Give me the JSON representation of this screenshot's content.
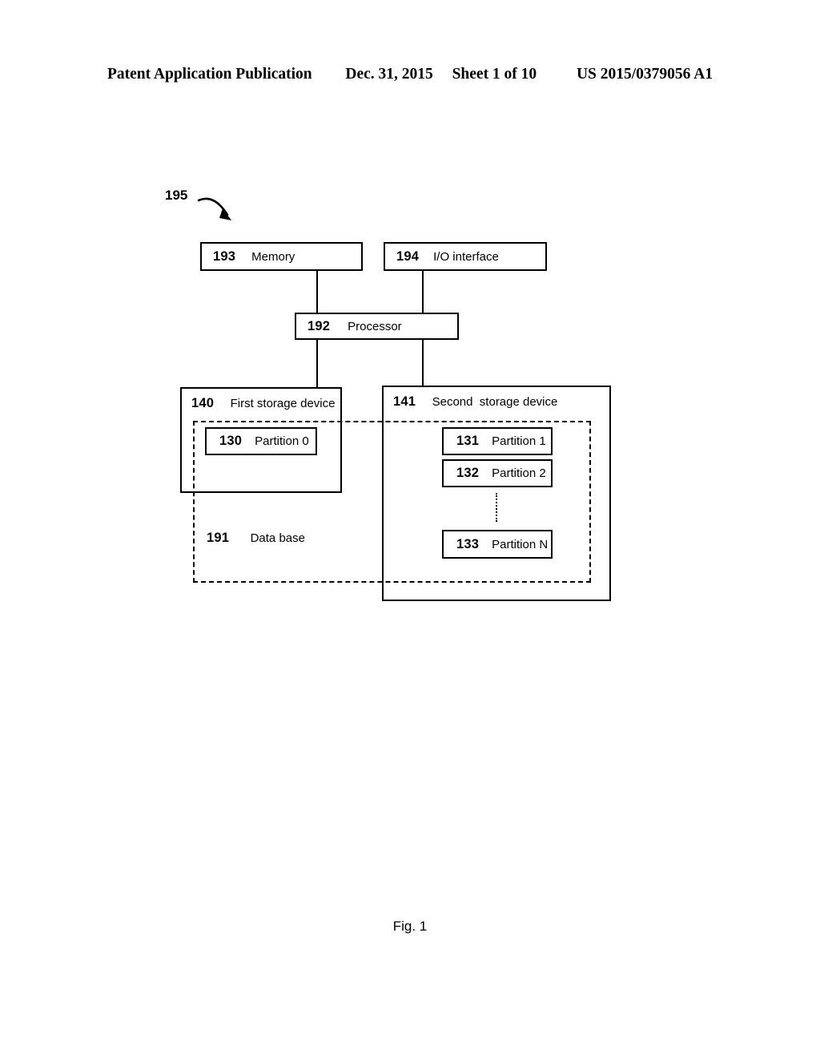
{
  "header": {
    "publication": "Patent Application Publication",
    "date": "Dec. 31, 2015",
    "sheet": "Sheet 1 of 10",
    "document_number": "US 2015/0379056 A1"
  },
  "figure": {
    "system_ref": "195",
    "caption": "Fig. 1",
    "blocks": {
      "memory": {
        "ref": "193",
        "label": "Memory"
      },
      "io": {
        "ref": "194",
        "label": "I/O interface"
      },
      "processor": {
        "ref": "192",
        "label": "Processor"
      },
      "first_storage": {
        "ref": "140",
        "label": "First storage device"
      },
      "second_storage": {
        "ref": "141",
        "label": "Second  storage device"
      },
      "database": {
        "ref": "191",
        "label": "Data base"
      }
    },
    "partitions": [
      {
        "ref": "130",
        "label": "Partition 0"
      },
      {
        "ref": "131",
        "label": "Partition 1"
      },
      {
        "ref": "132",
        "label": "Partition 2"
      },
      {
        "ref": "133",
        "label": "Partition N"
      }
    ]
  },
  "colors": {
    "ink": "#000000",
    "paper": "#ffffff"
  }
}
